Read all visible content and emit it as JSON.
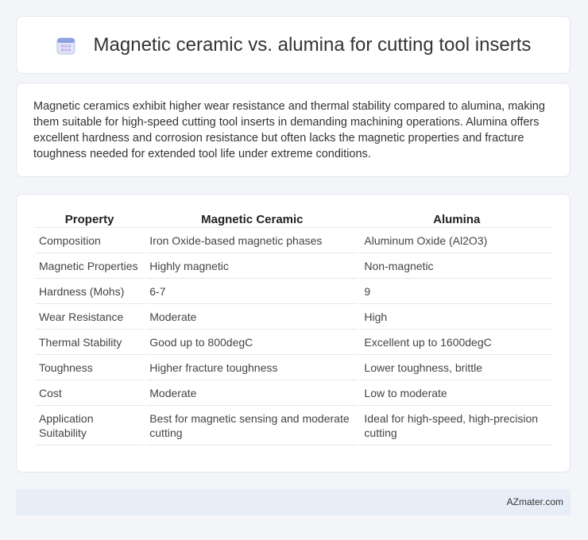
{
  "header": {
    "title": "Magnetic ceramic vs. alumina for cutting tool inserts",
    "icon": "calendar-icon"
  },
  "summary": {
    "text": "Magnetic ceramics exhibit higher wear resistance and thermal stability compared to alumina, making them suitable for high-speed cutting tool inserts in demanding machining operations. Alumina offers excellent hardness and corrosion resistance but often lacks the magnetic properties and fracture toughness needed for extended tool life under extreme conditions."
  },
  "table": {
    "headers": [
      "Property",
      "Magnetic Ceramic",
      "Alumina"
    ],
    "rows": [
      [
        "Composition",
        "Iron Oxide-based magnetic phases",
        "Aluminum Oxide (Al2O3)"
      ],
      [
        "Magnetic Properties",
        "Highly magnetic",
        "Non-magnetic"
      ],
      [
        "Hardness (Mohs)",
        "6-7",
        "9"
      ],
      [
        "Wear Resistance",
        "Moderate",
        "High"
      ],
      [
        "Thermal Stability",
        "Good up to 800degC",
        "Excellent up to 1600degC"
      ],
      [
        "Toughness",
        "Higher fracture toughness",
        "Lower toughness, brittle"
      ],
      [
        "Cost",
        "Moderate",
        "Low to moderate"
      ],
      [
        "Application Suitability",
        "Best for magnetic sensing and moderate cutting",
        "Ideal for high-speed, high-precision cutting"
      ]
    ]
  },
  "footer": {
    "text": "AZmater.com"
  },
  "colors": {
    "background": "#f3f5f9",
    "card": "#ffffff",
    "footer": "#e8eef7",
    "icon_accent": "#7b8fd6"
  }
}
